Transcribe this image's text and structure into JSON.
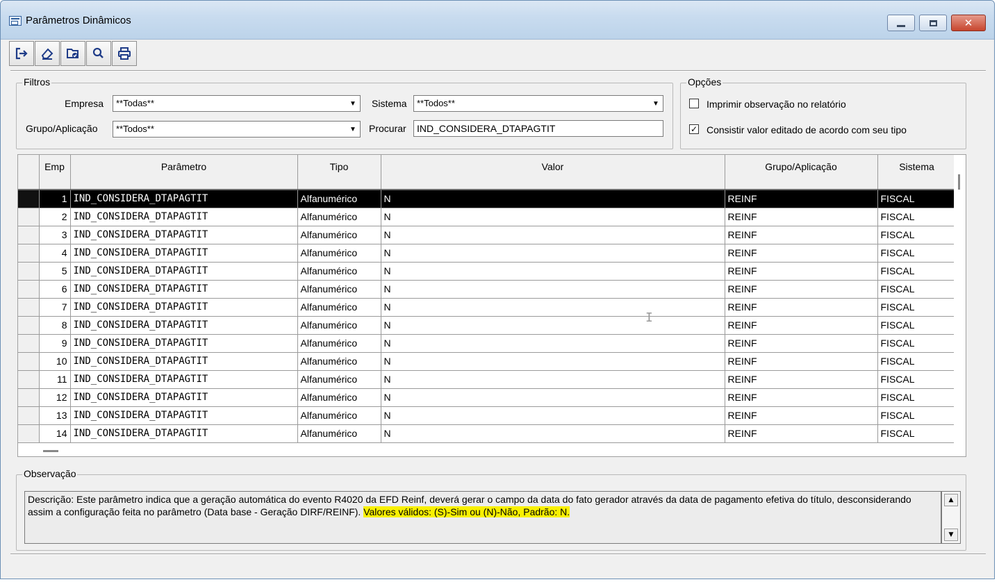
{
  "window": {
    "title": "Parâmetros Dinâmicos"
  },
  "toolbar": {
    "buttons": [
      {
        "icon": "exit-icon",
        "glyph": "⇥"
      },
      {
        "icon": "eraser-icon",
        "glyph": "◇"
      },
      {
        "icon": "folder-check-icon",
        "glyph": "🗀"
      },
      {
        "icon": "search-icon",
        "glyph": "⌕"
      },
      {
        "icon": "print-icon",
        "glyph": "⎙"
      }
    ]
  },
  "filtros": {
    "legend": "Filtros",
    "empresa_label": "Empresa",
    "empresa_value": "**Todas**",
    "sistema_label": "Sistema",
    "sistema_value": "**Todos**",
    "grupo_label": "Grupo/Aplicação",
    "grupo_value": "**Todos**",
    "procurar_label": "Procurar",
    "procurar_value": "IND_CONSIDERA_DTAPAGTIT"
  },
  "opcoes": {
    "legend": "Opções",
    "imprimir_label": "Imprimir observação no relatório",
    "imprimir_checked": false,
    "consistir_label": "Consistir valor editado de acordo com seu tipo",
    "consistir_checked": true
  },
  "grid": {
    "columns": [
      "Emp",
      "Parâmetro",
      "Tipo",
      "Valor",
      "Grupo/Aplicação",
      "Sistema"
    ],
    "selected_row": 0,
    "rows": [
      {
        "emp": "1",
        "parametro": "IND_CONSIDERA_DTAPAGTIT",
        "tipo": "Alfanumérico",
        "valor": "N",
        "grupo": "REINF",
        "sistema": "FISCAL"
      },
      {
        "emp": "2",
        "parametro": "IND_CONSIDERA_DTAPAGTIT",
        "tipo": "Alfanumérico",
        "valor": "N",
        "grupo": "REINF",
        "sistema": "FISCAL"
      },
      {
        "emp": "3",
        "parametro": "IND_CONSIDERA_DTAPAGTIT",
        "tipo": "Alfanumérico",
        "valor": "N",
        "grupo": "REINF",
        "sistema": "FISCAL"
      },
      {
        "emp": "4",
        "parametro": "IND_CONSIDERA_DTAPAGTIT",
        "tipo": "Alfanumérico",
        "valor": "N",
        "grupo": "REINF",
        "sistema": "FISCAL"
      },
      {
        "emp": "5",
        "parametro": "IND_CONSIDERA_DTAPAGTIT",
        "tipo": "Alfanumérico",
        "valor": "N",
        "grupo": "REINF",
        "sistema": "FISCAL"
      },
      {
        "emp": "6",
        "parametro": "IND_CONSIDERA_DTAPAGTIT",
        "tipo": "Alfanumérico",
        "valor": "N",
        "grupo": "REINF",
        "sistema": "FISCAL"
      },
      {
        "emp": "7",
        "parametro": "IND_CONSIDERA_DTAPAGTIT",
        "tipo": "Alfanumérico",
        "valor": "N",
        "grupo": "REINF",
        "sistema": "FISCAL"
      },
      {
        "emp": "8",
        "parametro": "IND_CONSIDERA_DTAPAGTIT",
        "tipo": "Alfanumérico",
        "valor": "N",
        "grupo": "REINF",
        "sistema": "FISCAL"
      },
      {
        "emp": "9",
        "parametro": "IND_CONSIDERA_DTAPAGTIT",
        "tipo": "Alfanumérico",
        "valor": "N",
        "grupo": "REINF",
        "sistema": "FISCAL"
      },
      {
        "emp": "10",
        "parametro": "IND_CONSIDERA_DTAPAGTIT",
        "tipo": "Alfanumérico",
        "valor": "N",
        "grupo": "REINF",
        "sistema": "FISCAL"
      },
      {
        "emp": "11",
        "parametro": "IND_CONSIDERA_DTAPAGTIT",
        "tipo": "Alfanumérico",
        "valor": "N",
        "grupo": "REINF",
        "sistema": "FISCAL"
      },
      {
        "emp": "12",
        "parametro": "IND_CONSIDERA_DTAPAGTIT",
        "tipo": "Alfanumérico",
        "valor": "N",
        "grupo": "REINF",
        "sistema": "FISCAL"
      },
      {
        "emp": "13",
        "parametro": "IND_CONSIDERA_DTAPAGTIT",
        "tipo": "Alfanumérico",
        "valor": "N",
        "grupo": "REINF",
        "sistema": "FISCAL"
      },
      {
        "emp": "14",
        "parametro": "IND_CONSIDERA_DTAPAGTIT",
        "tipo": "Alfanumérico",
        "valor": "N",
        "grupo": "REINF",
        "sistema": "FISCAL"
      }
    ]
  },
  "observacao": {
    "legend": "Observação",
    "text": "Descrição: Este parâmetro indica que a geração automática do evento R4020 da EFD Reinf, deverá gerar o campo da data do fato gerador através da data de pagamento efetiva do título, desconsiderando assim a configuração feita no parâmetro (Data base - Geração DIRF/REINF). ",
    "highlight": "Valores válidos: (S)-Sim ou (N)-Não, Padrão: N.",
    "highlight_color": "#f8f000"
  }
}
